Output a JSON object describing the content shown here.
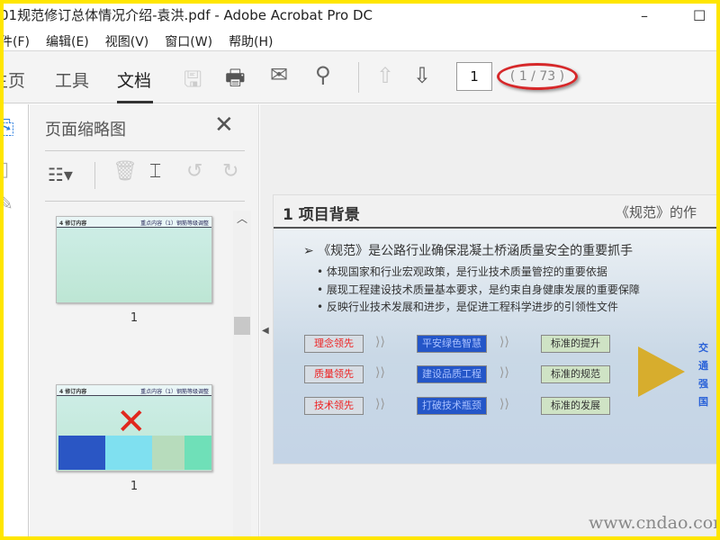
{
  "window": {
    "title": "01规范修订总体情况介绍-袁洪.pdf - Adobe Acrobat Pro DC",
    "minimize": "–",
    "maximize": "☐"
  },
  "menu": [
    "件(F)",
    "编辑(E)",
    "视图(V)",
    "窗口(W)",
    "帮助(H)"
  ],
  "tabs": [
    {
      "label": "主页"
    },
    {
      "label": "工具"
    },
    {
      "label": "文档"
    }
  ],
  "toolbar": {
    "page_input": "1",
    "page_count": "( 1 / 73 )"
  },
  "thumbnails_panel": {
    "title": "页面缩略图",
    "close": "✕",
    "thumbs": [
      {
        "heading": "4 修订内容",
        "subheading": "重点内容（1）钢筋等级调整",
        "label": "1"
      },
      {
        "heading": "4 修订内容",
        "subheading": "重点内容（1）钢筋等级调整",
        "label": "1"
      }
    ]
  },
  "slide": {
    "title": "1 项目背景",
    "header_right": "《规范》的作",
    "main_point": "《规范》是公路行业确保混凝土桥涵质量安全的重要抓手",
    "bullets": [
      "体现国家和行业宏观政策，是行业技术质量管控的重要依据",
      "展现工程建设技术质量基本要求，是约束自身健康发展的重要保障",
      "反映行业技术发展和进步，是促进工程科学进步的引领性文件"
    ],
    "rows": [
      {
        "left": "理念领先",
        "mid": "平安绿色智慧",
        "right": "标准的提升"
      },
      {
        "left": "质量领先",
        "mid": "建设品质工程",
        "right": "标准的规范"
      },
      {
        "left": "技术领先",
        "mid": "打破技术瓶颈",
        "right": "标准的发展"
      }
    ],
    "side_text": [
      "交",
      "通",
      "强",
      "国"
    ]
  },
  "watermark": "www.cndao.com",
  "colors": {
    "border": "#ffe600",
    "highlight_ellipse": "#d6282a",
    "blue_box": "#2456c8"
  }
}
